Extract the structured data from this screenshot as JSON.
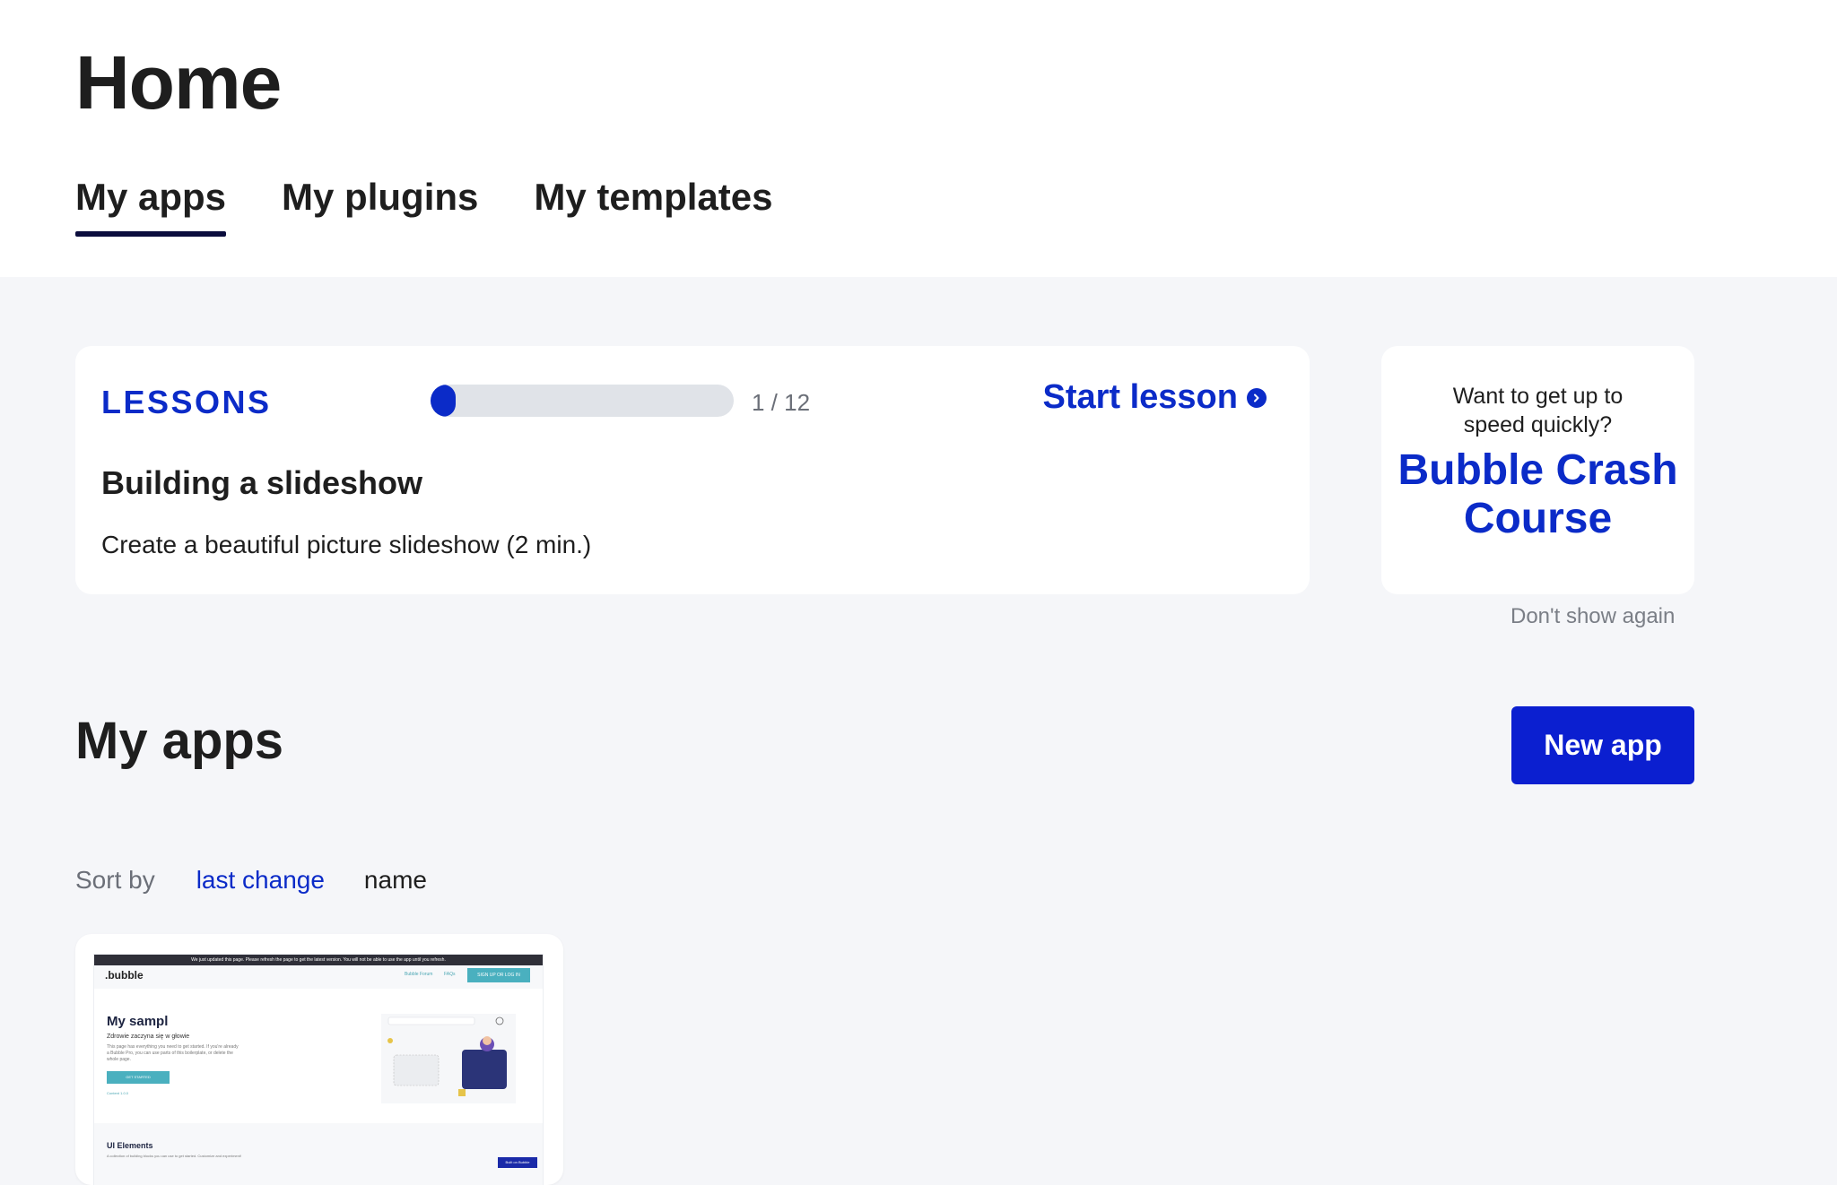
{
  "header": {
    "title": "Home",
    "tabs": [
      {
        "label": "My apps",
        "active": true
      },
      {
        "label": "My plugins",
        "active": false
      },
      {
        "label": "My templates",
        "active": false
      }
    ]
  },
  "lessons": {
    "heading": "LESSONS",
    "progress_text": "1 / 12",
    "progress_fraction": 0.083,
    "start_label": "Start lesson",
    "title": "Building a slideshow",
    "description": "Create a beautiful picture slideshow (2 min.)"
  },
  "crash_course": {
    "subtitle": "Want to get up to speed quickly?",
    "title": "Bubble Crash Course",
    "dismiss_label": "Don't show again"
  },
  "apps_section": {
    "title": "My apps",
    "new_app_label": "New app",
    "sort_label": "Sort by",
    "sort_options": [
      {
        "label": "last change",
        "active": true
      },
      {
        "label": "name",
        "active": false
      }
    ]
  },
  "app_thumbnail": {
    "banner": "We just updated this page. Please refresh the page to get the latest version. You will not be able to use the app until you refresh.",
    "logo": ".bubble",
    "nav_links": [
      "Bubble Forum",
      "FAQs"
    ],
    "signup": "SIGN UP OR LOG IN",
    "heading": "My sampl",
    "subheading": "Zdrowie zaczyna się w głowie",
    "body": "This page has everything you need to get started. If you're already a Bubble Pro, you can use parts of this boilerplate, or delete the whole page.",
    "cta": "GET STARTED",
    "small_text": "Content 1.0.0",
    "section_title": "UI Elements",
    "section_sub": "A collection of building blocks you can use to get started. Customize and experiment!",
    "built_badge": "Built on Bubble"
  },
  "colors": {
    "brand_blue": "#0b2bc8",
    "button_blue": "#0b1fd0",
    "tab_underline": "#0b0d3d",
    "page_bg": "#f5f6f9"
  },
  "icons": {
    "start_lesson": "chevron-right-circle-icon"
  }
}
